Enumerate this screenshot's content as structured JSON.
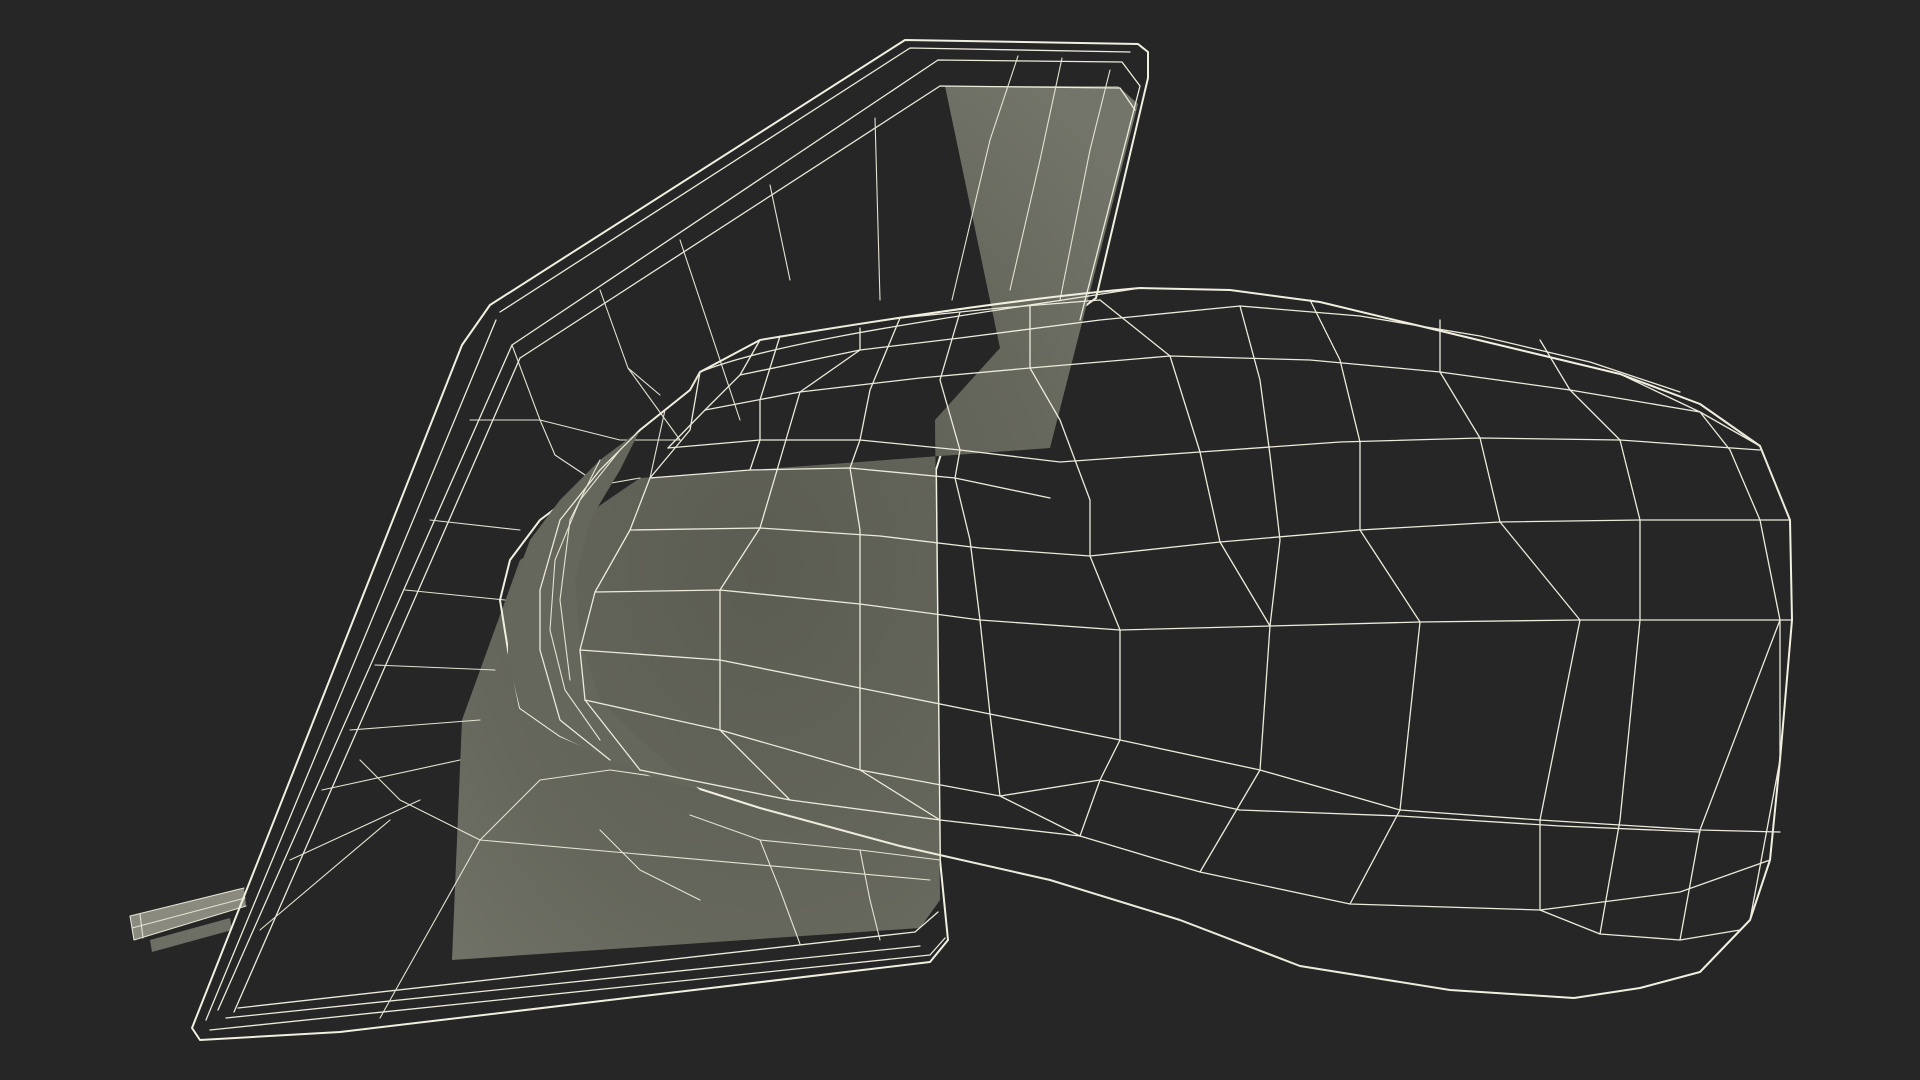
{
  "scene": {
    "subject": "car-side-mirror-wireframe",
    "colors": {
      "background": "#262626",
      "surface_main": "#7b7c70",
      "surface_dark": "#5c5d53",
      "surface_mid": "#6d6e63",
      "wire": "#eceadb"
    }
  }
}
